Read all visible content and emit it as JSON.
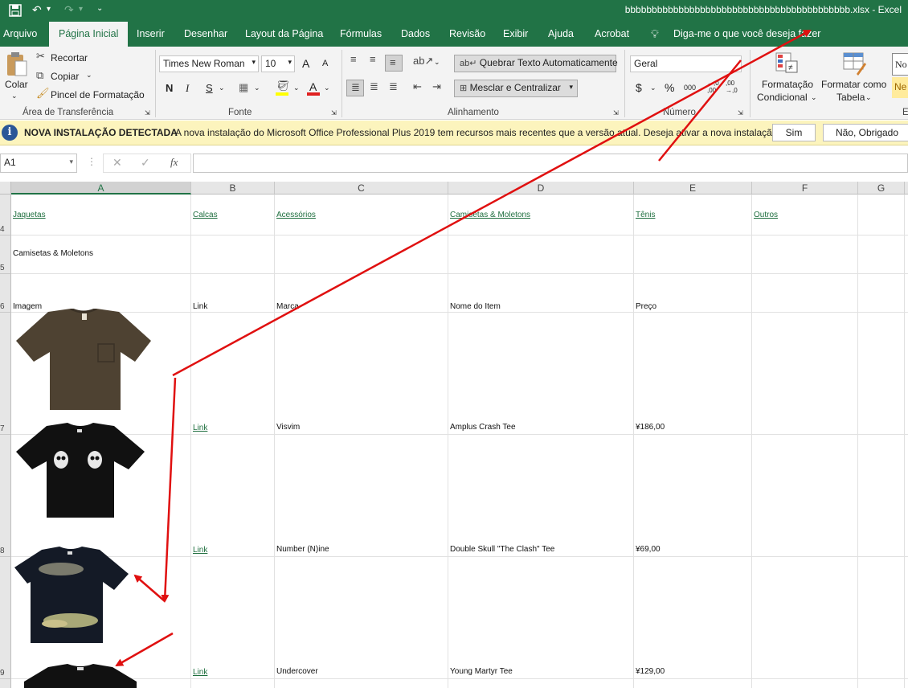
{
  "titlebar": {
    "title": "bbbbbbbbbbbbbbbbbbbbbbbbbbbbbbbbbbbbbbbbbb.xlsx  -  Excel",
    "save_icon": "save-icon",
    "undo_icon": "undo-icon",
    "redo_icon": "redo-icon"
  },
  "tabs": [
    "Arquivo",
    "Página Inicial",
    "Inserir",
    "Desenhar",
    "Layout da Página",
    "Fórmulas",
    "Dados",
    "Revisão",
    "Exibir",
    "Ajuda",
    "Acrobat"
  ],
  "tell_me": "Diga-me o que você deseja fazer",
  "ribbon": {
    "clipboard": {
      "paste": "Colar",
      "cut": "Recortar",
      "copy": "Copiar",
      "format_painter": "Pincel de Formatação",
      "label": "Área de Transferência"
    },
    "font": {
      "name": "Times New Roman",
      "size": "10",
      "grow": "A",
      "shrink": "A",
      "bold": "N",
      "italic": "I",
      "underline": "S",
      "label": "Fonte"
    },
    "alignment": {
      "wrap": "Quebrar Texto Automaticamente",
      "merge": "Mesclar e Centralizar",
      "label": "Alinhamento"
    },
    "number": {
      "format": "Geral",
      "currency": "$",
      "percent": "%",
      "thousands": "000",
      "inc_decimal": "←,0 ,00",
      "dec_decimal": ",00 →,0",
      "label": "Número"
    },
    "styles": {
      "conditional_1": "Formatação",
      "conditional_2": "Condicional",
      "table_1": "Formatar como",
      "table_2": "Tabela",
      "style_preview_1": "No",
      "style_preview_2": "Ne",
      "label_partial": "E"
    }
  },
  "infobar": {
    "heading": "NOVA INSTALAÇÃO DETECTADA",
    "message": "A nova instalação do Microsoft Office Professional Plus 2019 tem recursos mais recentes que a versão atual. Deseja ativar a nova instalação?",
    "yes": "Sim",
    "no": "Não, Obrigado"
  },
  "formula_bar": {
    "name_box": "A1",
    "fx": "fx",
    "value": ""
  },
  "sheet": {
    "columns": [
      "A",
      "B",
      "C",
      "D",
      "E",
      "F",
      "G"
    ],
    "rows": [
      {
        "num": "4",
        "cells": [
          "Jaquetas",
          "Calcas",
          "Acessórios",
          "Camisetas & Moletons",
          "Tênis",
          "Outros"
        ]
      },
      {
        "num": "5",
        "cells": [
          "Camisetas & Moletons",
          "",
          "",
          "",
          "",
          ""
        ]
      },
      {
        "num": "6",
        "cells": [
          "Imagem",
          "Link",
          "Marca",
          "Nome do Item",
          "Preço",
          ""
        ]
      },
      {
        "num": "7",
        "cells": [
          "",
          "Link",
          "Visvim",
          "Amplus Crash Tee",
          "¥186,00",
          ""
        ]
      },
      {
        "num": "8",
        "cells": [
          "",
          "Link",
          "Number (N)ine",
          "Double Skull \"The Clash\" Tee",
          "¥69,00",
          ""
        ]
      },
      {
        "num": "9",
        "cells": [
          "",
          "Link",
          "Undercover",
          "Young Martyr Tee",
          "¥129,00",
          ""
        ]
      }
    ]
  },
  "colors": {
    "accent": "#217346",
    "annotation": "#e01010",
    "infobar": "#fcf4bd"
  }
}
